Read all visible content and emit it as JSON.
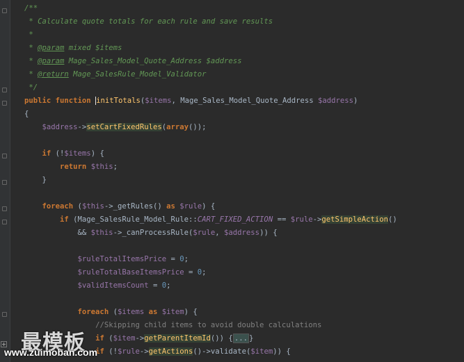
{
  "editor": {
    "lines": [
      {
        "parts": [
          {
            "t": "/**",
            "c": "c"
          }
        ]
      },
      {
        "parts": [
          {
            "t": " * Calculate quote totals for each rule and save results",
            "c": "c"
          }
        ]
      },
      {
        "parts": [
          {
            "t": " *",
            "c": "c"
          }
        ]
      },
      {
        "parts": [
          {
            "t": " * ",
            "c": "c"
          },
          {
            "t": "@param",
            "c": "ct"
          },
          {
            "t": " mixed $items",
            "c": "c"
          }
        ]
      },
      {
        "parts": [
          {
            "t": " * ",
            "c": "c"
          },
          {
            "t": "@param",
            "c": "ct"
          },
          {
            "t": " Mage_Sales_Model_Quote_Address $address",
            "c": "c"
          }
        ]
      },
      {
        "parts": [
          {
            "t": " * ",
            "c": "c"
          },
          {
            "t": "@return",
            "c": "ct"
          },
          {
            "t": " Mage_SalesRule_Model_Validator",
            "c": "c"
          }
        ]
      },
      {
        "parts": [
          {
            "t": " */",
            "c": "c"
          }
        ]
      },
      {
        "parts": [
          {
            "t": "public function ",
            "c": "k"
          },
          {
            "t": "initTotals",
            "c": "m"
          },
          {
            "t": "(",
            "c": "p"
          },
          {
            "t": "$items",
            "c": "v"
          },
          {
            "t": ", Mage_Sales_Model_Quote_Address ",
            "c": "p"
          },
          {
            "t": "$address",
            "c": "v"
          },
          {
            "t": ")",
            "c": "p"
          }
        ]
      },
      {
        "parts": [
          {
            "t": "{",
            "c": "p"
          }
        ]
      },
      {
        "parts": [
          {
            "t": "    ",
            "c": "p"
          },
          {
            "t": "$address",
            "c": "v"
          },
          {
            "t": "->",
            "c": "p"
          },
          {
            "t": "setCartFixedRules",
            "c": "hl"
          },
          {
            "t": "(",
            "c": "p"
          },
          {
            "t": "array",
            "c": "k"
          },
          {
            "t": "());",
            "c": "p"
          }
        ]
      },
      {
        "parts": [
          {
            "t": "",
            "c": "p"
          }
        ]
      },
      {
        "parts": [
          {
            "t": "    ",
            "c": "p"
          },
          {
            "t": "if ",
            "c": "k"
          },
          {
            "t": "(!",
            "c": "p"
          },
          {
            "t": "$items",
            "c": "v"
          },
          {
            "t": ") {",
            "c": "p"
          }
        ]
      },
      {
        "parts": [
          {
            "t": "        ",
            "c": "p"
          },
          {
            "t": "return ",
            "c": "k"
          },
          {
            "t": "$this",
            "c": "v"
          },
          {
            "t": ";",
            "c": "p"
          }
        ]
      },
      {
        "parts": [
          {
            "t": "    }",
            "c": "p"
          }
        ]
      },
      {
        "parts": [
          {
            "t": "",
            "c": "p"
          }
        ]
      },
      {
        "parts": [
          {
            "t": "    ",
            "c": "p"
          },
          {
            "t": "foreach ",
            "c": "k"
          },
          {
            "t": "(",
            "c": "p"
          },
          {
            "t": "$this",
            "c": "v"
          },
          {
            "t": "->_getRules() ",
            "c": "p"
          },
          {
            "t": "as ",
            "c": "k"
          },
          {
            "t": "$rule",
            "c": "v"
          },
          {
            "t": ") {",
            "c": "p"
          }
        ]
      },
      {
        "parts": [
          {
            "t": "        ",
            "c": "p"
          },
          {
            "t": "if ",
            "c": "k"
          },
          {
            "t": "(Mage_SalesRule_Model_Rule::",
            "c": "p"
          },
          {
            "t": "CART_FIXED_ACTION",
            "c": "cst"
          },
          {
            "t": " == ",
            "c": "p"
          },
          {
            "t": "$rule",
            "c": "v"
          },
          {
            "t": "->",
            "c": "p"
          },
          {
            "t": "getSimpleAction",
            "c": "hl"
          },
          {
            "t": "()",
            "c": "p"
          }
        ]
      },
      {
        "parts": [
          {
            "t": "            && ",
            "c": "p"
          },
          {
            "t": "$this",
            "c": "v"
          },
          {
            "t": "->_canProcessRule(",
            "c": "p"
          },
          {
            "t": "$rule",
            "c": "v"
          },
          {
            "t": ", ",
            "c": "p"
          },
          {
            "t": "$address",
            "c": "v"
          },
          {
            "t": ")) {",
            "c": "p"
          }
        ]
      },
      {
        "parts": [
          {
            "t": "",
            "c": "p"
          }
        ]
      },
      {
        "parts": [
          {
            "t": "            ",
            "c": "p"
          },
          {
            "t": "$ruleTotalItemsPrice",
            "c": "v"
          },
          {
            "t": " = ",
            "c": "p"
          },
          {
            "t": "0",
            "c": "n"
          },
          {
            "t": ";",
            "c": "p"
          }
        ]
      },
      {
        "parts": [
          {
            "t": "            ",
            "c": "p"
          },
          {
            "t": "$ruleTotalBaseItemsPrice",
            "c": "v"
          },
          {
            "t": " = ",
            "c": "p"
          },
          {
            "t": "0",
            "c": "n"
          },
          {
            "t": ";",
            "c": "p"
          }
        ]
      },
      {
        "parts": [
          {
            "t": "            ",
            "c": "p"
          },
          {
            "t": "$validItemsCount",
            "c": "v"
          },
          {
            "t": " = ",
            "c": "p"
          },
          {
            "t": "0",
            "c": "n"
          },
          {
            "t": ";",
            "c": "p"
          }
        ]
      },
      {
        "parts": [
          {
            "t": "",
            "c": "p"
          }
        ]
      },
      {
        "parts": [
          {
            "t": "            ",
            "c": "p"
          },
          {
            "t": "foreach ",
            "c": "k"
          },
          {
            "t": "(",
            "c": "p"
          },
          {
            "t": "$items",
            "c": "v"
          },
          {
            "t": " as ",
            "c": "k"
          },
          {
            "t": "$item",
            "c": "v"
          },
          {
            "t": ") {",
            "c": "p"
          }
        ]
      },
      {
        "parts": [
          {
            "t": "                ",
            "c": "p"
          },
          {
            "t": "//Skipping child items to avoid double calculations",
            "c": "gc"
          }
        ]
      },
      {
        "parts": [
          {
            "t": "                ",
            "c": "p"
          },
          {
            "t": "if ",
            "c": "k"
          },
          {
            "t": "(",
            "c": "p"
          },
          {
            "t": "$item",
            "c": "v"
          },
          {
            "t": "->",
            "c": "p"
          },
          {
            "t": "getParentItemId",
            "c": "hl"
          },
          {
            "t": "()) {",
            "c": "p"
          },
          {
            "t": "...",
            "c": "fold-tag"
          },
          {
            "t": "}",
            "c": "p"
          }
        ]
      },
      {
        "parts": [
          {
            "t": "                ",
            "c": "p"
          },
          {
            "t": "if ",
            "c": "k"
          },
          {
            "t": "(!",
            "c": "p"
          },
          {
            "t": "$rule",
            "c": "v"
          },
          {
            "t": "->",
            "c": "p"
          },
          {
            "t": "getActions",
            "c": "hl"
          },
          {
            "t": "()->validate(",
            "c": "p"
          },
          {
            "t": "$item",
            "c": "v"
          },
          {
            "t": ")) {",
            "c": "p"
          }
        ]
      }
    ]
  },
  "watermark": {
    "logo": "最模板",
    "url": "www.zuimoban.com"
  }
}
